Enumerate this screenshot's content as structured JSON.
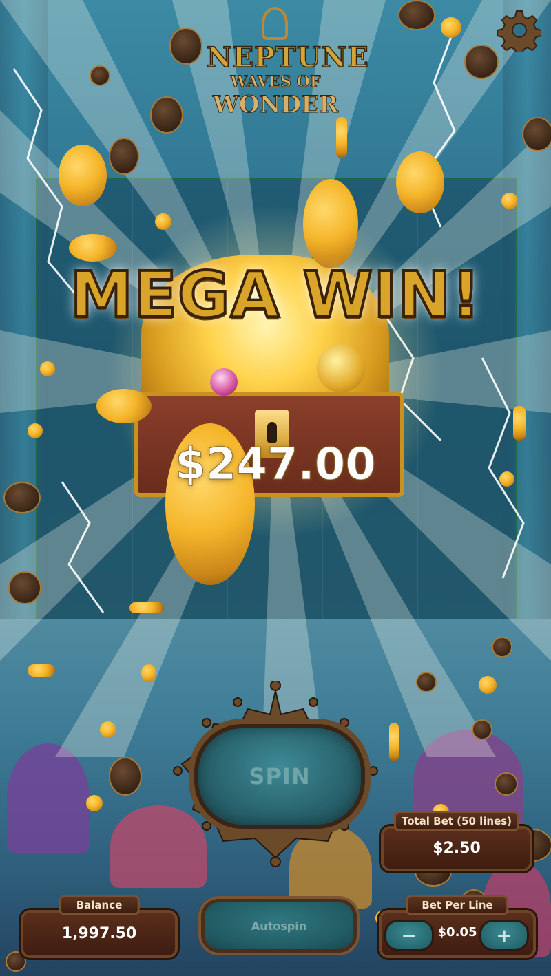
{
  "game": {
    "logo_line1": "NEPTUNE",
    "logo_line2": "WAVES OF",
    "logo_line3": "WONDER"
  },
  "win": {
    "headline": "MEGA WIN!",
    "amount": "$247.00"
  },
  "controls": {
    "spin_label": "SPIN",
    "autospin_label": "Autospin",
    "balance_label": "Balance",
    "balance_value": "1,997.50",
    "total_bet_label": "Total Bet (50 lines)",
    "total_bet_value": "$2.50",
    "bet_per_line_label": "Bet Per Line",
    "bet_per_line_value": "$0.05",
    "minus_label": "−",
    "plus_label": "+"
  },
  "icons": {
    "settings": "gear-icon",
    "emblem": "trident-emblem-icon"
  },
  "colors": {
    "gold": "#d9a42a",
    "panel_brown": "#5a2e1c",
    "spin_teal": "#2a6670"
  }
}
